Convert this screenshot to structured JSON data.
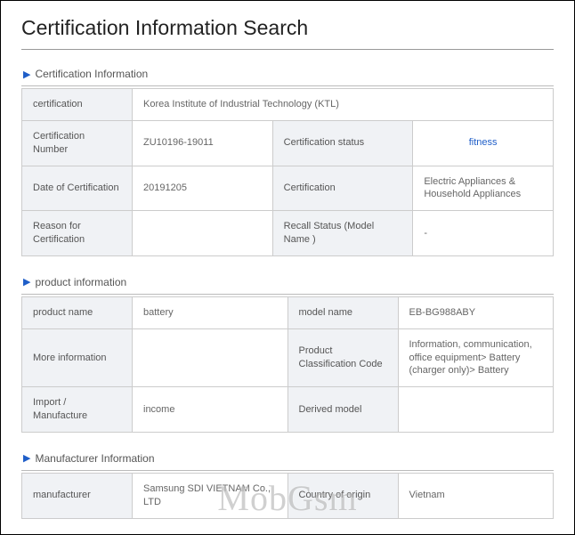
{
  "page": {
    "title": "Certification Information Search"
  },
  "sections": {
    "cert": {
      "header": "Certification Information"
    },
    "product": {
      "header": "product information"
    },
    "manufacturer": {
      "header": "Manufacturer Information"
    }
  },
  "cert": {
    "certification_label": "certification",
    "certification_value": "Korea Institute of Industrial Technology (KTL)",
    "number_label": "Certification Number",
    "number_value": "ZU10196-19011",
    "status_label": "Certification status",
    "status_value": "fitness",
    "date_label": "Date of Certification",
    "date_value": "20191205",
    "type_label": "Certification",
    "type_value": "Electric Appliances & Household Appliances",
    "reason_label": "Reason for Certification",
    "reason_value": "",
    "recall_label": "Recall Status (Model Name )",
    "recall_value": "-"
  },
  "product": {
    "name_label": "product name",
    "name_value": "battery",
    "model_label": "model name",
    "model_value": "EB-BG988ABY",
    "more_label": "More information",
    "more_value": "",
    "class_label": "Product Classification Code",
    "class_value": "Information, communication, office equipment> Battery (charger only)> Battery",
    "import_label": "Import / Manufacture",
    "import_value": "income",
    "derived_label": "Derived model",
    "derived_value": ""
  },
  "manufacturer": {
    "name_label": "manufacturer",
    "name_value": "Samsung SDI VIETNAM Co., LTD",
    "origin_label": "Country of origin",
    "origin_value": "Vietnam"
  },
  "watermark": "MobGsm"
}
